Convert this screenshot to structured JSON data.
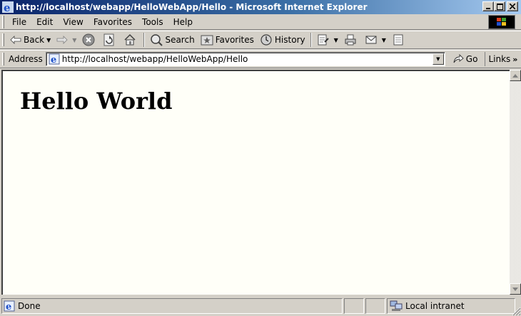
{
  "window": {
    "title": "http://localhost/webapp/HelloWebApp/Hello - Microsoft Internet Explorer",
    "controls": {
      "minimize": "_",
      "maximize": "□",
      "close": "×"
    }
  },
  "menu": {
    "items": [
      "File",
      "Edit",
      "View",
      "Favorites",
      "Tools",
      "Help"
    ]
  },
  "toolbar": {
    "back_label": "Back",
    "search_label": "Search",
    "favorites_label": "Favorites",
    "history_label": "History"
  },
  "address": {
    "label": "Address",
    "url": "http://localhost/webapp/HelloWebApp/Hello",
    "go_label": "Go",
    "links_label": "Links",
    "links_chevron": "»"
  },
  "page": {
    "heading": "Hello World"
  },
  "status": {
    "text": "Done",
    "zone": "Local intranet"
  },
  "colors": {
    "title_gradient_start": "#0a246a",
    "title_gradient_end": "#a6caf0",
    "chrome": "#d4d0c8",
    "content_bg": "#fffff8"
  },
  "icons": {
    "title": "ie-logo-icon",
    "back": "back-arrow-icon",
    "forward": "forward-arrow-icon",
    "stop": "stop-icon",
    "refresh": "refresh-icon",
    "home": "home-icon",
    "search": "search-icon",
    "favorites": "favorites-icon",
    "history": "history-icon",
    "edit": "edit-icon",
    "print": "print-icon",
    "mail": "mail-icon",
    "discuss": "discuss-icon",
    "page": "ie-page-icon",
    "go": "go-arrow-icon",
    "zone": "intranet-zone-icon"
  }
}
